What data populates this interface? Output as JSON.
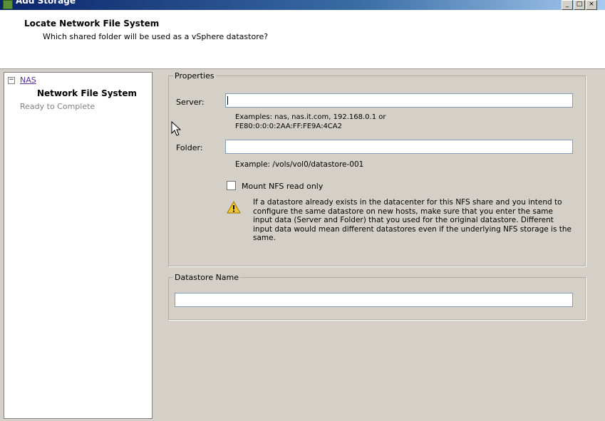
{
  "window": {
    "title": "Add Storage",
    "buttons": [
      "_",
      "□",
      "×"
    ]
  },
  "header": {
    "title": "Locate Network File System",
    "subtitle": "Which shared folder will be used as a vSphere datastore?"
  },
  "nav": {
    "toggle": "−",
    "items": [
      {
        "label": "NAS",
        "state": "link"
      },
      {
        "label": "Network File System",
        "state": "current"
      },
      {
        "label": "Ready to Complete",
        "state": "disabled"
      }
    ]
  },
  "properties": {
    "legend": "Properties",
    "server": {
      "label": "Server:",
      "value": "",
      "example_line1": "Examples: nas, nas.it.com, 192.168.0.1 or",
      "example_line2": "FE80:0:0:0:2AA:FF:FE9A:4CA2"
    },
    "folder": {
      "label": "Folder:",
      "value": "",
      "example": "Example: /vols/vol0/datastore-001"
    },
    "mount_read_only": {
      "label": "Mount NFS read only",
      "checked": false
    },
    "warning": {
      "icon": "warning-icon",
      "text": "If a datastore already exists in the datacenter for this NFS share and you intend to configure the same datastore on new hosts, make sure that you enter the same input data (Server and Folder) that you used for the original datastore. Different input data would mean different datastores even if the underlying NFS storage is the same."
    }
  },
  "datastore": {
    "legend": "Datastore Name",
    "value": ""
  },
  "colors": {
    "link": "#5a2d9a",
    "titlebar": "#0a246a",
    "dialog_bg": "#d4d0c8"
  }
}
